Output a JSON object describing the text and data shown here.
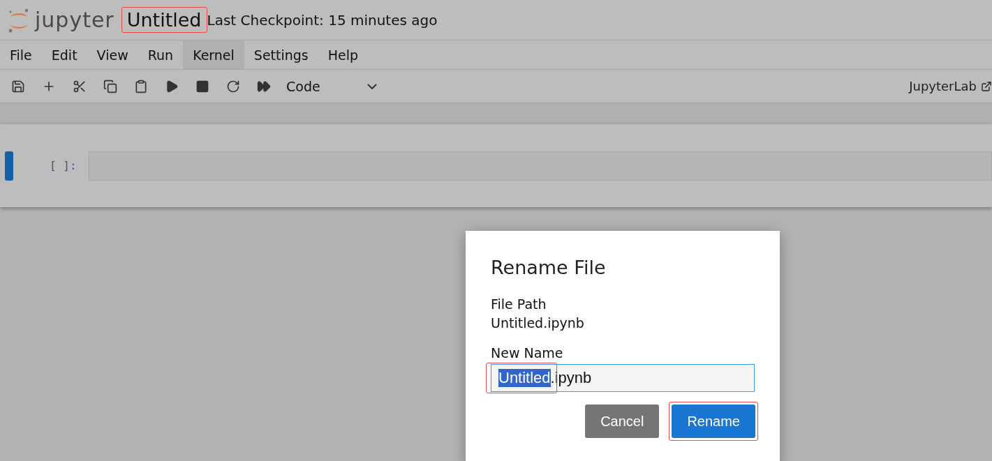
{
  "header": {
    "logo_text": "jupyter",
    "notebook_title": "Untitled",
    "title_highlighted": true,
    "checkpoint": "Last Checkpoint: 15 minutes ago"
  },
  "menu": [
    {
      "label": "File",
      "selected": false
    },
    {
      "label": "Edit",
      "selected": false
    },
    {
      "label": "View",
      "selected": false
    },
    {
      "label": "Run",
      "selected": false
    },
    {
      "label": "Kernel",
      "selected": true
    },
    {
      "label": "Settings",
      "selected": false
    },
    {
      "label": "Help",
      "selected": false
    }
  ],
  "toolbar": {
    "cell_type": "Code",
    "jupyterlab_link": "JupyterLab"
  },
  "cell": {
    "prompt": "[ ]:"
  },
  "dialog": {
    "title": "Rename File",
    "path_label": "File Path",
    "path": "Untitled.ipynb",
    "name_label": "New Name",
    "name_selected": "Untitled",
    "name_rest": ".ipynb",
    "selection_highlighted": true,
    "buttons": [
      {
        "label": "Cancel",
        "kind": "secondary",
        "highlighted": false
      },
      {
        "label": "Rename",
        "kind": "primary",
        "highlighted": true
      }
    ]
  }
}
